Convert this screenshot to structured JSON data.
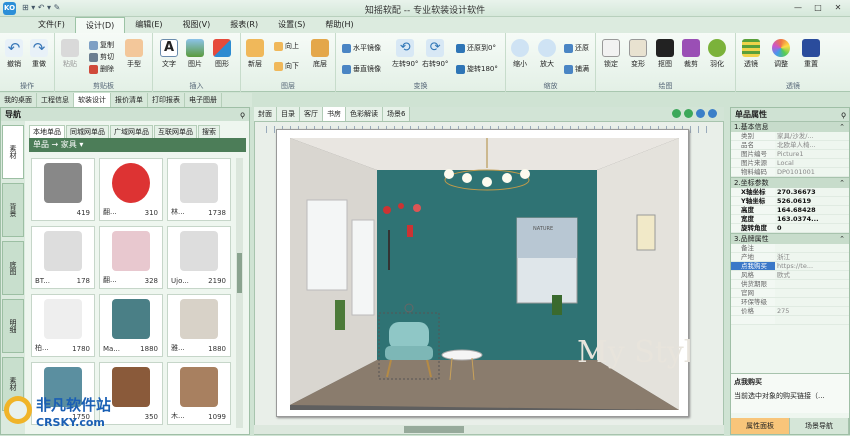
{
  "app": {
    "title": "知摇软配 -- 专业软装设计软件",
    "logo": "KO"
  },
  "menu": [
    "文件(F)",
    "设计(D)",
    "编辑(E)",
    "视图(V)",
    "报表(R)",
    "设置(S)",
    "帮助(H)"
  ],
  "ribbon": {
    "groups": {
      "g1": "操作",
      "g2": "剪贴板",
      "g3": "插入",
      "g4": "图层",
      "g5": "变换",
      "g6": "缩放",
      "g7": "绘图",
      "g8": "透镜"
    },
    "undo": "撤销",
    "redo": "重做",
    "paste": "粘贴",
    "copy": "复制",
    "cut": "剪切",
    "del": "删除",
    "hand": "手型",
    "text": "文字",
    "image": "图片",
    "shape": "图形",
    "new_layer": "新层",
    "up": "向上",
    "down": "向下",
    "bottom": "底层",
    "hmirror": "水平镜像",
    "vmirror": "垂直镜像",
    "rot_l": "左转90°",
    "rot_r": "右转90°",
    "restore0": "还原到0°",
    "rot180": "旋转180°",
    "zoom_out": "缩小",
    "zoom_in": "放大",
    "reset": "还原",
    "fill": "铺满",
    "lock": "锁定",
    "deform": "变形",
    "cutout": "抠图",
    "crop": "裁剪",
    "feather": "羽化",
    "lens": "透镜",
    "adjust": "调整",
    "reset2": "重置"
  },
  "left_tabs": [
    "我的桌面",
    "工程信息",
    "软装设计",
    "报价清单",
    "打印报表",
    "电子图册"
  ],
  "nav": {
    "title": "导航",
    "pin": "ϙ",
    "vtabs": [
      "素材",
      "背景",
      "底图",
      "明细",
      "素材"
    ],
    "subtabs": [
      "本地单品",
      "同城网单品",
      "广域网单品",
      "互联网单品",
      "搜索"
    ],
    "category": "单品  →  家具 ▾",
    "items": [
      {
        "name": "",
        "code": "419"
      },
      {
        "name": "翻...",
        "code": "310"
      },
      {
        "name": "林...",
        "code": "1738"
      },
      {
        "name": "BT...",
        "code": "178"
      },
      {
        "name": "翻...",
        "code": "328"
      },
      {
        "name": "Ujo...",
        "code": "2190"
      },
      {
        "name": "柏...",
        "code": "1780"
      },
      {
        "name": "Ma...",
        "code": "1880"
      },
      {
        "name": "雅...",
        "code": "1880"
      },
      {
        "name": "",
        "code": "1750"
      },
      {
        "name": "",
        "code": "350"
      },
      {
        "name": "木...",
        "code": "1099"
      }
    ]
  },
  "doc_tabs": [
    "封面",
    "目录",
    "客厅",
    "书房",
    "色彩解读",
    "场景6"
  ],
  "canvas": {
    "style_text": "My Style",
    "nature_text": "NATURE"
  },
  "props": {
    "title": "单品属性",
    "pin": "ϙ",
    "sections": [
      {
        "title": "1.基本信息",
        "rows": [
          [
            "类别",
            "家具/沙发/..."
          ],
          [
            "品名",
            "北欧单人椅..."
          ],
          [
            "图片编号",
            "Picture1"
          ],
          [
            "图片来源",
            "Local"
          ],
          [
            "物料编码",
            "DP0101001"
          ]
        ]
      },
      {
        "title": "2.坐标参数",
        "rows": [
          [
            "X轴坐标",
            "270.36673"
          ],
          [
            "Y轴坐标",
            "526.0619"
          ],
          [
            "高度",
            "164.68428"
          ],
          [
            "宽度",
            "163.0374..."
          ],
          [
            "旋转角度",
            "0"
          ]
        ]
      },
      {
        "title": "3.品牌属性",
        "rows": [
          [
            "备注",
            ""
          ],
          [
            "产地",
            "浙江"
          ],
          [
            "点我购买",
            "https://te..."
          ],
          [
            "风格",
            "欧式"
          ],
          [
            "供货期限",
            ""
          ],
          [
            "官网",
            ""
          ],
          [
            "环保等级",
            ""
          ],
          [
            "价格",
            "275"
          ],
          [
            "",
            ""
          ]
        ]
      }
    ],
    "desc_title": "点我购买",
    "desc_text": "当前选中对象的购买链接（...",
    "tab1": "属性面板",
    "tab2": "场景导航"
  },
  "watermark": {
    "cn": "非凡软件站",
    "en": "CRSKY.com"
  }
}
